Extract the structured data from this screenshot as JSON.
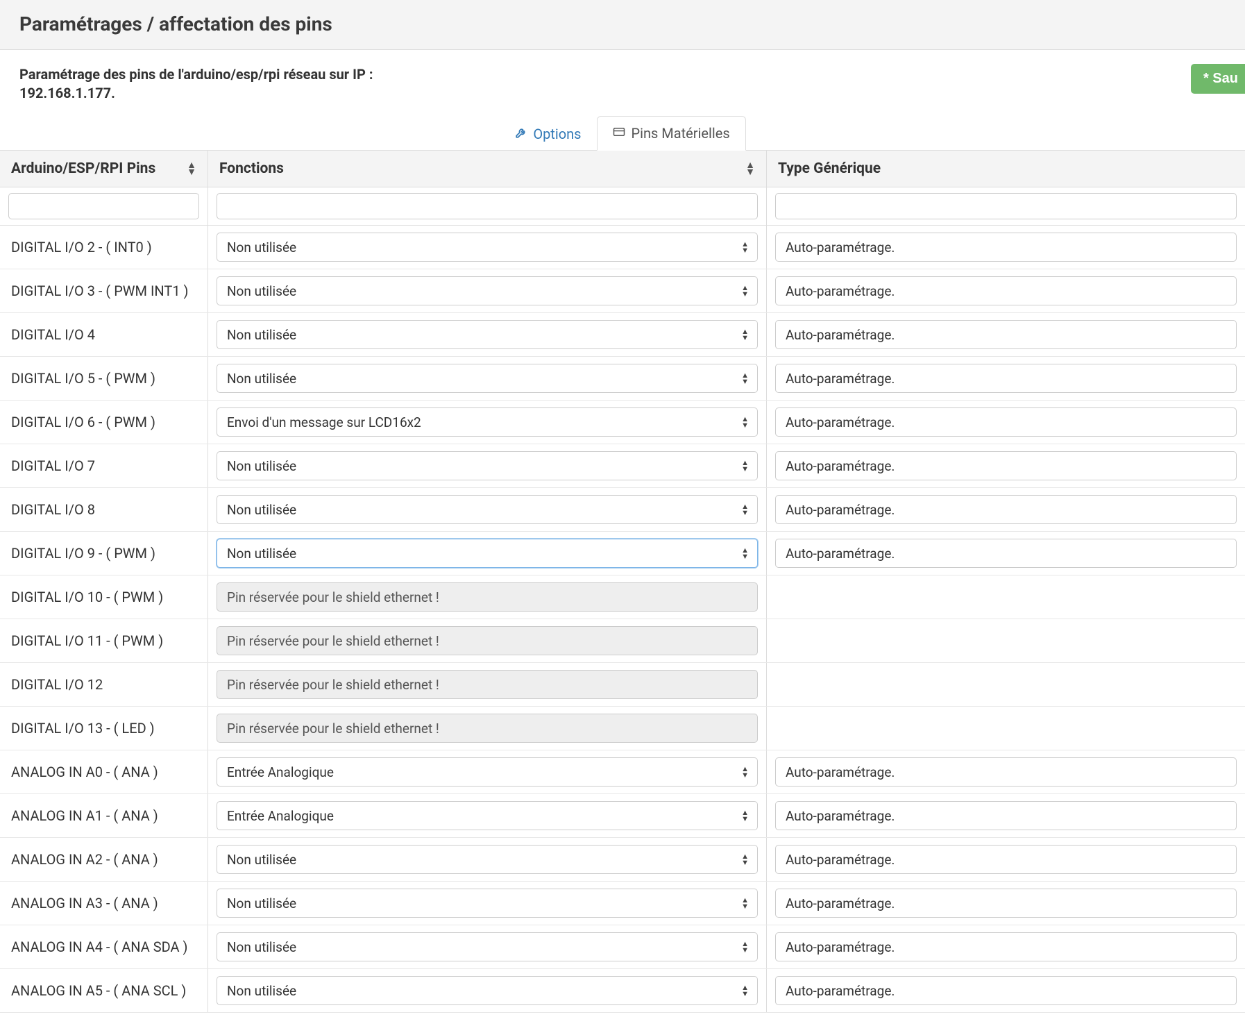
{
  "header": {
    "title": "Paramétrages / affectation des pins"
  },
  "subhead": {
    "line1": "Paramétrage des pins de l'arduino/esp/rpi réseau sur IP :",
    "line2": "192.168.1.177."
  },
  "buttons": {
    "save": "* Sau"
  },
  "tabs": {
    "options": "Options",
    "pins": "Pins Matérielles"
  },
  "columns": {
    "pin": "Arduino/ESP/RPI Pins",
    "func": "Fonctions",
    "type": "Type Générique"
  },
  "values": {
    "none": "Non utilisée",
    "lcd": "Envoi d'un message sur LCD16x2",
    "reserved": "Pin réservée pour le shield ethernet !",
    "analog": "Entrée Analogique",
    "auto": "Auto-paramétrage."
  },
  "rows": [
    {
      "pin": "DIGITAL I/O 2 - ( INT0 )",
      "func": "none",
      "type": "auto"
    },
    {
      "pin": "DIGITAL I/O 3 - ( PWM INT1 )",
      "func": "none",
      "type": "auto"
    },
    {
      "pin": "DIGITAL I/O 4",
      "func": "none",
      "type": "auto"
    },
    {
      "pin": "DIGITAL I/O 5 - ( PWM )",
      "func": "none",
      "type": "auto"
    },
    {
      "pin": "DIGITAL I/O 6 - ( PWM )",
      "func": "lcd",
      "type": "auto"
    },
    {
      "pin": "DIGITAL I/O 7",
      "func": "none",
      "type": "auto"
    },
    {
      "pin": "DIGITAL I/O 8",
      "func": "none",
      "type": "auto"
    },
    {
      "pin": "DIGITAL I/O 9 - ( PWM )",
      "func": "none",
      "type": "auto",
      "focused": true
    },
    {
      "pin": "DIGITAL I/O 10 - ( PWM )",
      "func": "reserved"
    },
    {
      "pin": "DIGITAL I/O 11 - ( PWM )",
      "func": "reserved"
    },
    {
      "pin": "DIGITAL I/O 12",
      "func": "reserved"
    },
    {
      "pin": "DIGITAL I/O 13 - ( LED )",
      "func": "reserved"
    },
    {
      "pin": "ANALOG IN A0 - ( ANA )",
      "func": "analog",
      "type": "auto"
    },
    {
      "pin": "ANALOG IN A1 - ( ANA )",
      "func": "analog",
      "type": "auto"
    },
    {
      "pin": "ANALOG IN A2 - ( ANA )",
      "func": "none",
      "type": "auto"
    },
    {
      "pin": "ANALOG IN A3 - ( ANA )",
      "func": "none",
      "type": "auto"
    },
    {
      "pin": "ANALOG IN A4 - ( ANA SDA )",
      "func": "none",
      "type": "auto"
    },
    {
      "pin": "ANALOG IN A5 - ( ANA SCL )",
      "func": "none",
      "type": "auto"
    }
  ]
}
